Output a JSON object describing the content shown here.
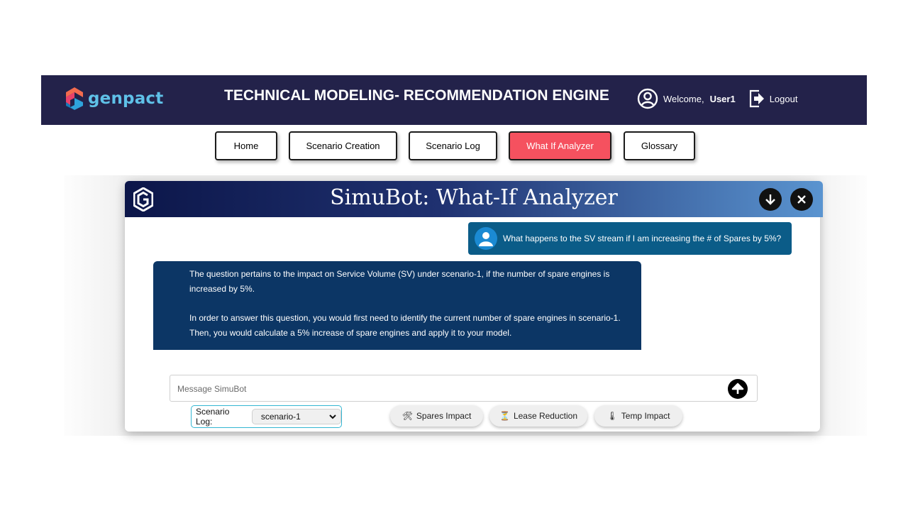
{
  "header": {
    "brand": "genpact",
    "title": "TECHNICAL MODELING- RECOMMENDATION ENGINE",
    "welcome": "Welcome,",
    "username": "User1",
    "logout": "Logout",
    "icons": {
      "user": "user-circle-icon",
      "logout": "logout-icon"
    }
  },
  "nav": {
    "items": [
      {
        "label": "Home"
      },
      {
        "label": "Scenario Creation"
      },
      {
        "label": "Scenario Log"
      },
      {
        "label": "What If Analyzer",
        "active": true
      },
      {
        "label": "Glossary"
      }
    ]
  },
  "chat": {
    "title": "SimuBot: What-If Analyzer",
    "user_message": "What happens to the SV stream if I am increasing the # of Spares by 5%?",
    "bot_message": {
      "p1": "The question pertains to the impact on Service Volume (SV) under scenario-1, if the number of spare engines is increased by 5%.",
      "p2": "In order to answer this question, you would first need to identify the current number of spare engines in scenario-1. Then, you would calculate a 5% increase of spare engines and apply it to your model."
    },
    "input_placeholder": "Message SimuBot",
    "scenario_label": "Scenario Log:",
    "scenario_value": "scenario-1",
    "chips": [
      {
        "label": "Spares Impact",
        "icon": "🛠"
      },
      {
        "label": "Lease Reduction",
        "icon": "⏳"
      },
      {
        "label": "Temp Impact",
        "icon": "🌡"
      }
    ]
  },
  "colors": {
    "header_bg": "#23224a",
    "active_nav": "#f5515f",
    "user_bubble": "#0b5c88",
    "bot_bubble": "#0c3665",
    "accent": "#5fc1e8"
  }
}
